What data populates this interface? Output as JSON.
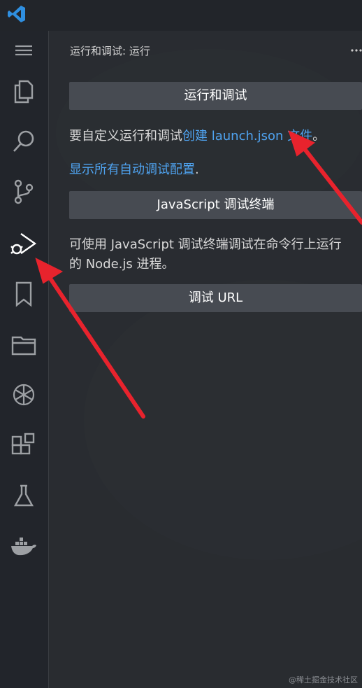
{
  "panel": {
    "title": "运行和调试: 运行"
  },
  "buttons": {
    "run_debug": "运行和调试",
    "js_debug_terminal": "JavaScript 调试终端",
    "debug_url": "调试 URL"
  },
  "text": {
    "customize_prefix": "要自定义运行和调试",
    "customize_link": "创建 launch.json 文件",
    "customize_suffix": "。",
    "show_all_link": "显示所有自动调试配置",
    "show_all_suffix": ".",
    "js_hint_line1": "可使用 JavaScript 调试终端调试在命令行上运行",
    "js_hint_line2": "的 Node.js 进程。"
  },
  "activity_bar": [
    {
      "icon": "menu-icon"
    },
    {
      "icon": "explorer-icon"
    },
    {
      "icon": "search-icon"
    },
    {
      "icon": "source-control-icon"
    },
    {
      "icon": "run-debug-icon"
    },
    {
      "icon": "bookmark-icon"
    },
    {
      "icon": "folder-icon"
    },
    {
      "icon": "openai-icon"
    },
    {
      "icon": "extensions-icon"
    },
    {
      "icon": "testing-icon"
    },
    {
      "icon": "docker-icon"
    }
  ],
  "watermark": "@稀土掘金技术社区",
  "colors": {
    "accent": "#4fa3f0",
    "annotation_arrow": "#e8232d",
    "button_bg": "#474b52"
  }
}
